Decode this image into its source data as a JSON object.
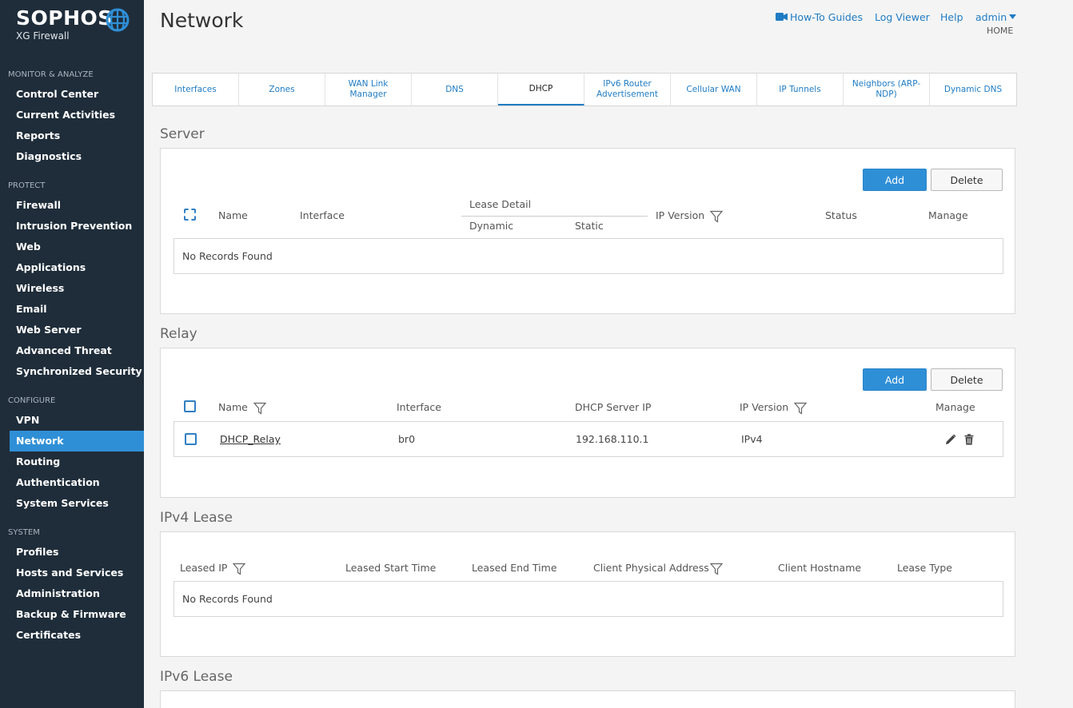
{
  "brand": {
    "name": "SOPHOS",
    "product": "XG Firewall"
  },
  "sidebar": {
    "sections": [
      {
        "label": "MONITOR & ANALYZE",
        "items": [
          "Control Center",
          "Current Activities",
          "Reports",
          "Diagnostics"
        ]
      },
      {
        "label": "PROTECT",
        "items": [
          "Firewall",
          "Intrusion Prevention",
          "Web",
          "Applications",
          "Wireless",
          "Email",
          "Web Server",
          "Advanced Threat",
          "Synchronized Security"
        ]
      },
      {
        "label": "CONFIGURE",
        "items": [
          "VPN",
          "Network",
          "Routing",
          "Authentication",
          "System Services"
        ]
      },
      {
        "label": "SYSTEM",
        "items": [
          "Profiles",
          "Hosts and Services",
          "Administration",
          "Backup & Firmware",
          "Certificates"
        ]
      }
    ],
    "active_item": "Network"
  },
  "header": {
    "title": "Network",
    "links": {
      "guides": "How-To Guides",
      "log_viewer": "Log Viewer",
      "help": "Help",
      "user": "admin"
    },
    "home": "HOME"
  },
  "tabs": [
    "Interfaces",
    "Zones",
    "WAN Link Manager",
    "DNS",
    "DHCP",
    "IPv6 Router Advertisement",
    "Cellular WAN",
    "IP Tunnels",
    "Neighbors (ARP-NDP)",
    "Dynamic DNS"
  ],
  "active_tab": "DHCP",
  "server": {
    "title": "Server",
    "add_label": "Add",
    "delete_label": "Delete",
    "columns": {
      "name": "Name",
      "interface": "Interface",
      "lease_detail": "Lease Detail",
      "dynamic": "Dynamic",
      "static": "Static",
      "ip_version": "IP Version",
      "status": "Status",
      "manage": "Manage"
    },
    "empty": "No Records Found"
  },
  "relay": {
    "title": "Relay",
    "add_label": "Add",
    "delete_label": "Delete",
    "columns": {
      "name": "Name",
      "interface": "Interface",
      "server_ip": "DHCP Server IP",
      "ip_version": "IP Version",
      "manage": "Manage"
    },
    "rows": [
      {
        "name": "DHCP_Relay",
        "interface": "br0",
        "server_ip": "192.168.110.1",
        "ip_version": "IPv4"
      }
    ]
  },
  "ipv4_lease": {
    "title": "IPv4 Lease",
    "columns": {
      "leased_ip": "Leased IP",
      "start": "Leased Start Time",
      "end": "Leased End Time",
      "mac": "Client Physical Address",
      "hostname": "Client Hostname",
      "type": "Lease Type"
    },
    "empty": "No Records Found"
  },
  "ipv6_lease": {
    "title": "IPv6 Lease"
  },
  "colors": {
    "sidebar_bg": "#1f2d3a",
    "accent": "#2f8fd6",
    "link": "#1f7cc4"
  }
}
